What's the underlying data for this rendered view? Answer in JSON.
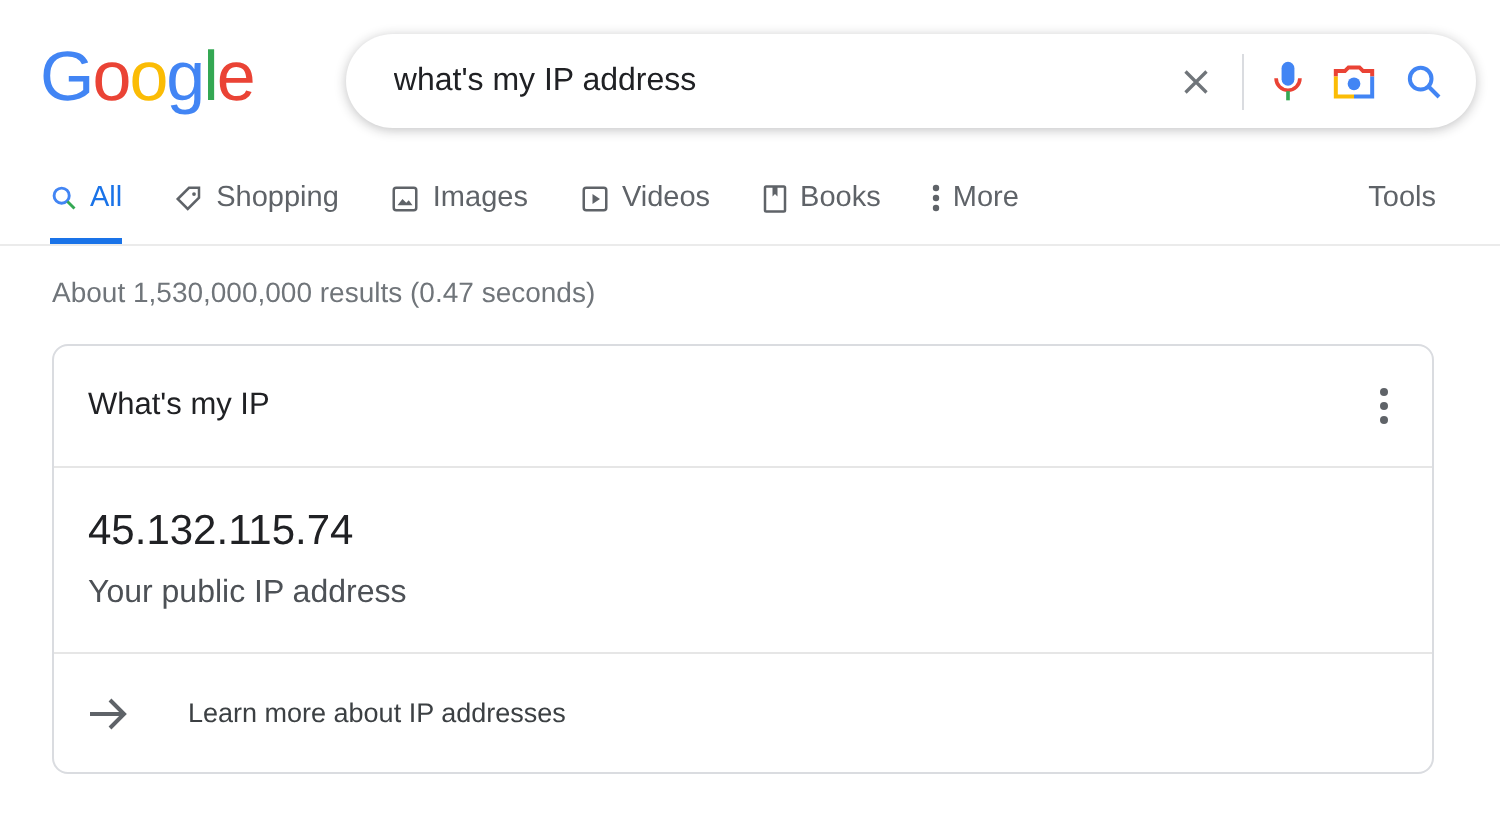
{
  "logo": "Google",
  "search": {
    "value": "what's my IP address"
  },
  "tabs": [
    {
      "label": "All",
      "selected": true
    },
    {
      "label": "Shopping",
      "selected": false
    },
    {
      "label": "Images",
      "selected": false
    },
    {
      "label": "Videos",
      "selected": false
    },
    {
      "label": "Books",
      "selected": false
    },
    {
      "label": "More",
      "selected": false
    }
  ],
  "tools": "Tools",
  "result_stats": "About 1,530,000,000 results (0.47 seconds)",
  "card": {
    "title": "What's my IP",
    "ip": "45.132.115.74",
    "caption": "Your public IP address",
    "link": "Learn more about IP addresses"
  }
}
